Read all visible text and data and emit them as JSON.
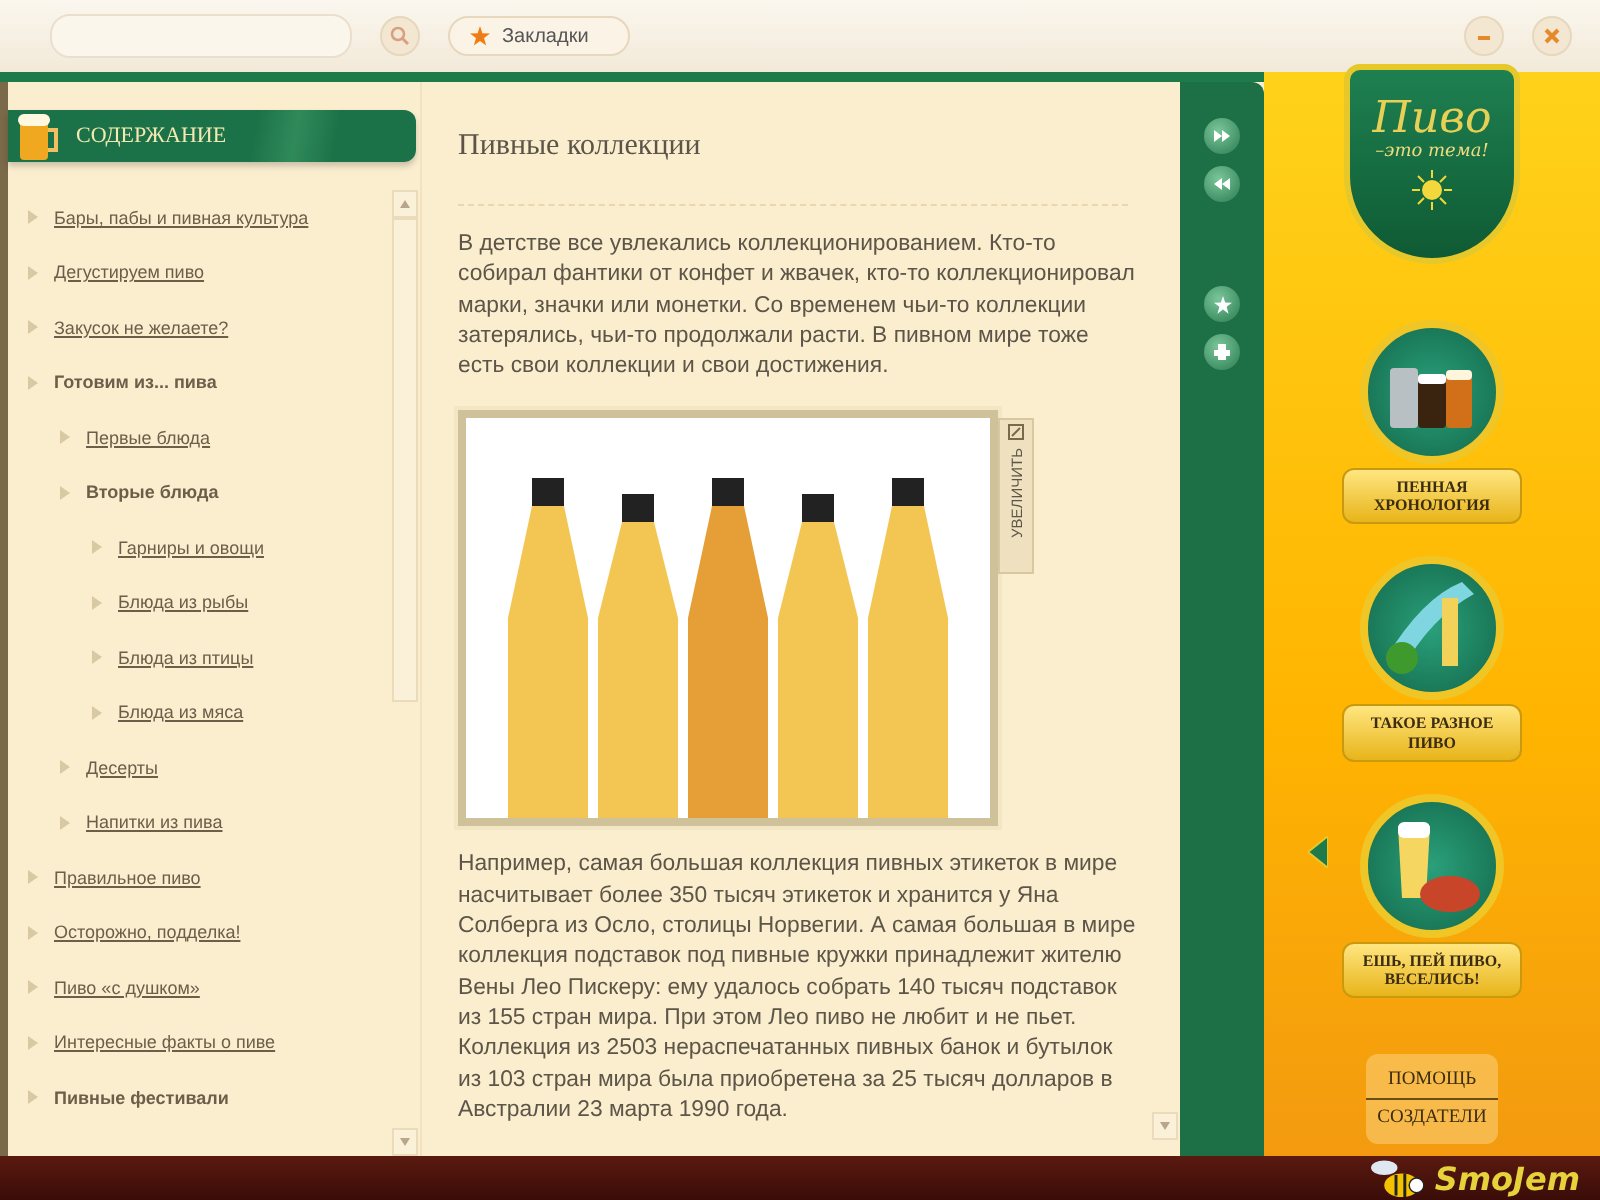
{
  "top_bar": {
    "bookmarks_label": "Закладки"
  },
  "sidebar": {
    "title": "СОДЕРЖАНИЕ",
    "items": [
      {
        "label": "Бары, пабы и пивная культура",
        "selected": false
      },
      {
        "label": "Дегустируем пиво",
        "selected": false
      },
      {
        "label": "Закусок не желаете?",
        "selected": false
      },
      {
        "label": "Готовим из... пива",
        "selected": true,
        "children": [
          {
            "label": "Первые блюда",
            "selected": false
          },
          {
            "label": "Вторые блюда",
            "selected": true,
            "children": [
              {
                "label": "Гарниры и овощи",
                "selected": false
              },
              {
                "label": "Блюда из рыбы",
                "selected": false
              },
              {
                "label": "Блюда из птицы",
                "selected": false
              },
              {
                "label": "Блюда из мяса",
                "selected": false
              }
            ]
          },
          {
            "label": "Десерты",
            "selected": false
          },
          {
            "label": "Напитки из пива",
            "selected": false
          }
        ]
      },
      {
        "label": "Правильное пиво",
        "selected": false
      },
      {
        "label": "Осторожно, подделка!",
        "selected": false
      },
      {
        "label": "Пиво «с душком»",
        "selected": false
      },
      {
        "label": "Интересные факты о пиве",
        "selected": false
      },
      {
        "label": "Пивные фестивали",
        "selected": true
      }
    ]
  },
  "article": {
    "title": "Пивные коллекции",
    "zoom_label": "УВЕЛИЧИТЬ",
    "paragraphs": [
      "В детстве все увлекались коллекционированием. Кто-то собирал фантики от конфет и жвачек, кто-то коллекционировал марки, значки или монетки. Со временем чьи-то коллекции затерялись, чьи-то продолжали расти. В пивном мире тоже есть свои коллекции и свои достижения.",
      "Например, самая большая коллекция пивных этикеток в мире насчитывает более 350 тысяч этикеток и хранится у Яна Солберга из Осло, столицы Норвегии. А самая большая в мире коллекция подставок под пивные кружки принадлежит жителю Вены Лео Пискеру: ему удалось собрать 140 тысяч подставок из 155 стран мира. При этом Лео пиво не любит и не пьет. Коллекция из 2503 нераспечатанных пивных банок и бутылок из 103 стран мира была приобретена за 25 тысяч долларов в Австралии 23 марта 1990 года."
    ]
  },
  "logo": {
    "title": "Пиво",
    "subtitle": "–это тема!"
  },
  "sections": [
    {
      "kind": "mugs",
      "label": "ПЕННАЯ\nХРОНОЛОГИЯ"
    },
    {
      "kind": "glass",
      "label": "ТАКОЕ РАЗНОЕ\nПИВО"
    },
    {
      "kind": "snack",
      "label": "ЕШЬ, ПЕЙ ПИВО,\nВЕСЕЛИСЬ!"
    }
  ],
  "footer_links": [
    "ПОМОЩЬ",
    "СОЗДАТЕЛИ"
  ],
  "brand": "SmoJem"
}
